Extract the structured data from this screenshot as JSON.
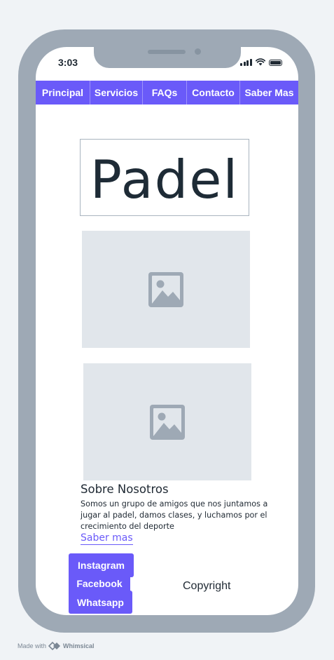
{
  "status_bar": {
    "time": "3:03"
  },
  "nav": {
    "items": [
      {
        "label": "Principal"
      },
      {
        "label": "Servicios"
      },
      {
        "label": "FAQs"
      },
      {
        "label": "Contacto"
      },
      {
        "label": "Saber Mas"
      }
    ]
  },
  "logo": {
    "text": "Padel"
  },
  "images": [
    {
      "icon": "image-placeholder-icon"
    },
    {
      "icon": "image-placeholder-icon"
    }
  ],
  "about": {
    "title": "Sobre Nosotros",
    "body": "Somos un grupo de amigos que nos juntamos a jugar al padel, damos clases, y luchamos por el crecimiento del deporte",
    "link_label": "Saber mas"
  },
  "footer": {
    "social": {
      "instagram": "Instagram",
      "facebook": "Facebook",
      "whatsapp": "Whatsapp"
    },
    "copyright": "Copyright"
  },
  "credit": {
    "prefix": "Made with",
    "brand": "Whimsical"
  },
  "colors": {
    "accent": "#6a5af9",
    "frame": "#9ea9b5",
    "background": "#f0f3f6",
    "placeholder": "#e1e6eb",
    "text": "#1f2933"
  }
}
